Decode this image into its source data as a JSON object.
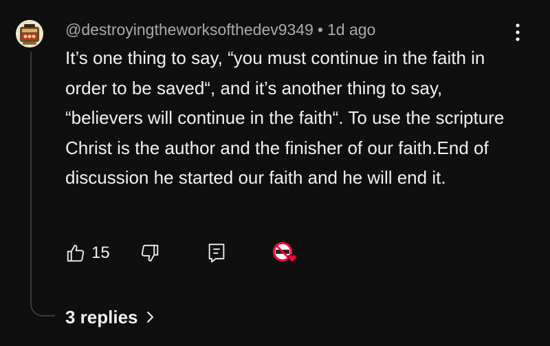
{
  "comment": {
    "author": "@destroyingtheworksofthedev9349",
    "separator": "•",
    "time": "1d ago",
    "text": "It’s one thing to say, “you must continue in the faith in order to be saved“, and it’s another thing to say, “believers will continue in the faith“. To use the scripture Christ is the author and the finisher of our faith.End of discussion he started our faith and he will end it.",
    "likes": "15",
    "replies_label": "3 replies"
  },
  "icons": {
    "avatar": "avatar-image",
    "menu": "vertical-ellipsis-icon",
    "like": "thumbs-up-icon",
    "dislike": "thumbs-down-icon",
    "reply": "reply-comment-icon",
    "creator_heart": "creator-heart-icon",
    "replies_chevron": "chevron-right-icon"
  },
  "colors": {
    "background": "#0f0f0f",
    "text": "#f1f1f1",
    "meta": "#aaaaaa",
    "heart": "#ff0033"
  }
}
